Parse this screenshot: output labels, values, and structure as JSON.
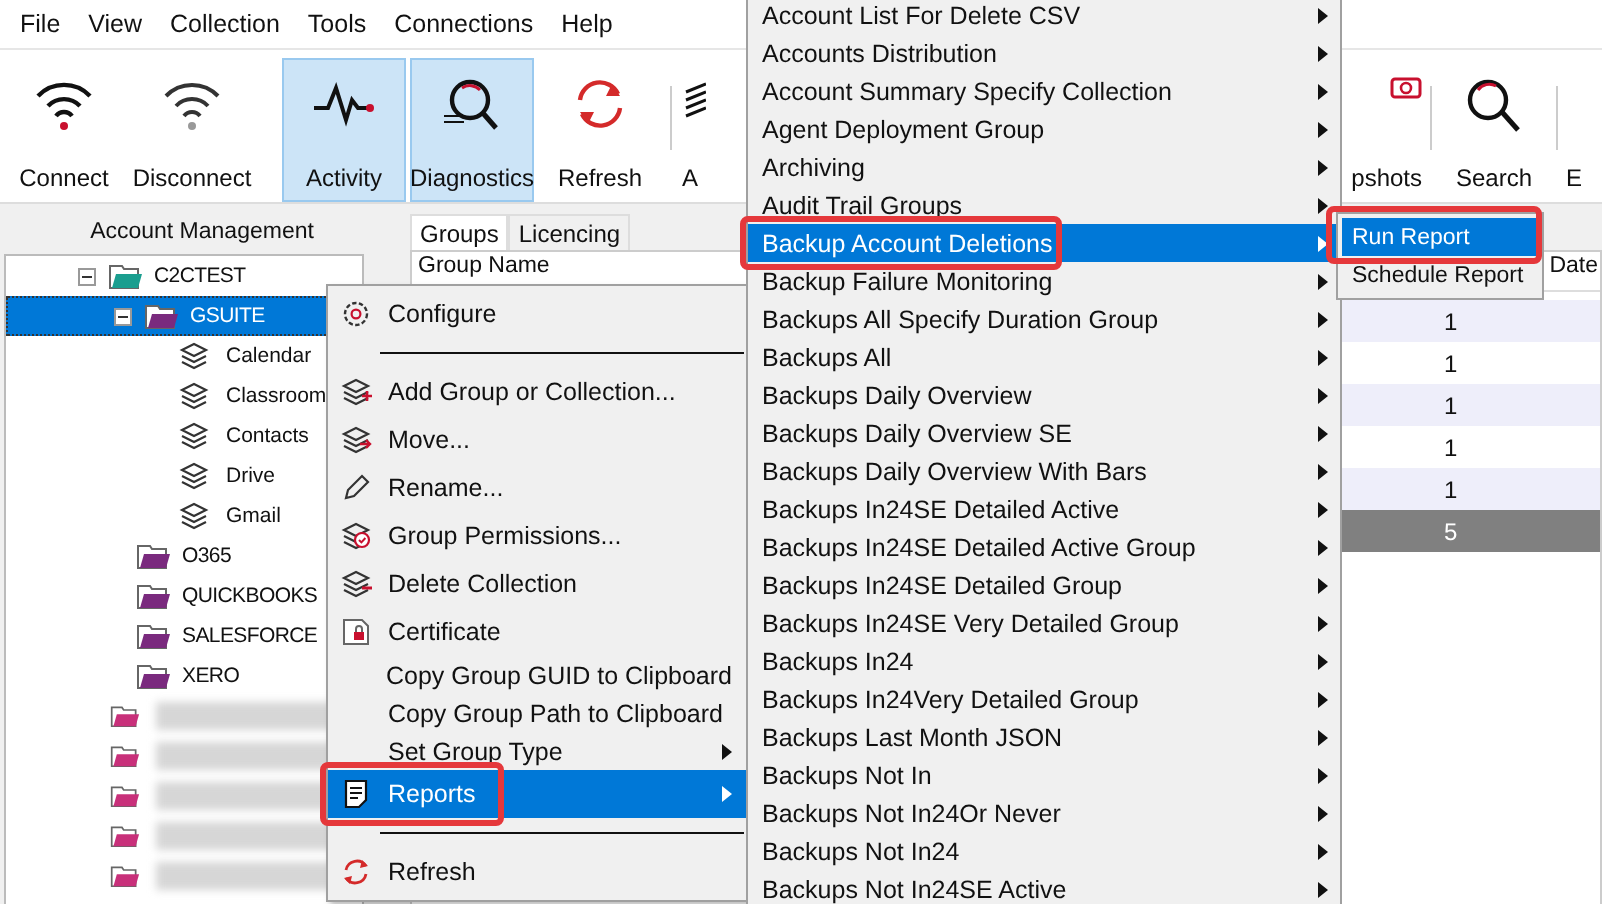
{
  "menu_bar": [
    "File",
    "View",
    "Collection",
    "Tools",
    "Connections",
    "Help"
  ],
  "toolbar": [
    {
      "label": "Connect",
      "selected": false
    },
    {
      "label": "Disconnect",
      "selected": false
    },
    {
      "label": "Activity",
      "selected": true
    },
    {
      "label": "Diagnostics",
      "selected": true
    },
    {
      "label": "Refresh",
      "selected": false
    },
    {
      "label": "A",
      "selected": false
    },
    {
      "label": "pshots",
      "selected": false
    },
    {
      "label": "Search",
      "selected": false
    },
    {
      "label": "E",
      "selected": false
    }
  ],
  "left_panel": {
    "title": "Account Management",
    "tree": [
      {
        "kind": "folder",
        "label": "C2CTEST",
        "color": "#1a9e8f",
        "expanded": true,
        "selected": false,
        "children": [
          {
            "kind": "folder",
            "label": "GSUITE",
            "color": "#7a2a7e",
            "expanded": true,
            "selected": true,
            "children": [
              {
                "kind": "collection",
                "label": "Calendar",
                "selected": false
              },
              {
                "kind": "collection",
                "label": "Classroom",
                "selected": false
              },
              {
                "kind": "collection",
                "label": "Contacts",
                "selected": false
              },
              {
                "kind": "collection",
                "label": "Drive",
                "selected": false
              },
              {
                "kind": "collection",
                "label": "Gmail",
                "selected": false
              }
            ]
          },
          {
            "kind": "folder",
            "label": "O365",
            "color": "#7a2a7e",
            "selected": false
          },
          {
            "kind": "folder",
            "label": "QUICKBOOKS",
            "color": "#7a2a7e",
            "selected": false
          },
          {
            "kind": "folder",
            "label": "SALESFORCE",
            "color": "#7a2a7e",
            "selected": false
          },
          {
            "kind": "folder",
            "label": "XERO",
            "color": "#7a2a7e",
            "selected": false
          }
        ]
      },
      {
        "kind": "blurred",
        "color": "#c8307a",
        "selected": false
      },
      {
        "kind": "blurred",
        "color": "#c8307a",
        "selected": false
      },
      {
        "kind": "blurred",
        "color": "#c8307a",
        "selected": false
      },
      {
        "kind": "blurred",
        "color": "#c8307a",
        "selected": false
      },
      {
        "kind": "blurred",
        "color": "#c8307a",
        "selected": false
      }
    ]
  },
  "tabs": [
    {
      "label": "Groups",
      "selected": true
    },
    {
      "label": "Licencing",
      "selected": false
    }
  ],
  "table": {
    "columns": [
      "Group Name",
      "Date"
    ],
    "rows": [
      {
        "value": "1",
        "selected": false
      },
      {
        "value": "1",
        "selected": false
      },
      {
        "value": "1",
        "selected": false
      },
      {
        "value": "1",
        "selected": false
      },
      {
        "value": "1",
        "selected": false
      },
      {
        "value": "5",
        "selected": true
      }
    ]
  },
  "context_menu": [
    {
      "kind": "item",
      "label": "Configure",
      "selected": false
    },
    {
      "kind": "separator"
    },
    {
      "kind": "item",
      "label": "Add Group or Collection...",
      "selected": false
    },
    {
      "kind": "item",
      "label": "Move...",
      "selected": false
    },
    {
      "kind": "item",
      "label": "Rename...",
      "selected": false
    },
    {
      "kind": "item",
      "label": "Group Permissions...",
      "selected": false
    },
    {
      "kind": "item",
      "label": "Delete Collection",
      "selected": false
    },
    {
      "kind": "item",
      "label": "Certificate",
      "selected": false
    },
    {
      "kind": "plain",
      "label": "Copy Group GUID to Clipboard",
      "selected": false
    },
    {
      "kind": "plain",
      "label": "Copy Group Path to Clipboard",
      "selected": false
    },
    {
      "kind": "submenu",
      "label": "Set Group Type",
      "selected": false
    },
    {
      "kind": "submenu",
      "label": "Reports",
      "selected": true
    },
    {
      "kind": "separator"
    },
    {
      "kind": "item",
      "label": "Refresh",
      "selected": false
    }
  ],
  "reports_menu": [
    {
      "label": "Account List For Delete CSV",
      "selected": false
    },
    {
      "label": "Accounts Distribution",
      "selected": false
    },
    {
      "label": "Account Summary Specify Collection",
      "selected": false
    },
    {
      "label": "Agent Deployment Group",
      "selected": false
    },
    {
      "label": "Archiving",
      "selected": false
    },
    {
      "label": "Audit Trail Groups",
      "selected": false
    },
    {
      "label": "Backup Account Deletions",
      "selected": true
    },
    {
      "label": "Backup Failure Monitoring",
      "selected": false
    },
    {
      "label": "Backups All Specify Duration Group",
      "selected": false
    },
    {
      "label": "Backups All",
      "selected": false
    },
    {
      "label": "Backups Daily Overview",
      "selected": false
    },
    {
      "label": "Backups Daily Overview SE",
      "selected": false
    },
    {
      "label": "Backups Daily Overview With Bars",
      "selected": false
    },
    {
      "label": "Backups In24SE Detailed Active",
      "selected": false
    },
    {
      "label": "Backups In24SE Detailed Active Group",
      "selected": false
    },
    {
      "label": "Backups In24SE Detailed Group",
      "selected": false
    },
    {
      "label": "Backups In24SE Very Detailed Group",
      "selected": false
    },
    {
      "label": "Backups In24",
      "selected": false
    },
    {
      "label": "Backups In24Very Detailed Group",
      "selected": false
    },
    {
      "label": "Backups Last Month JSON",
      "selected": false
    },
    {
      "label": "Backups Not In",
      "selected": false
    },
    {
      "label": "Backups Not In24Or Never",
      "selected": false
    },
    {
      "label": "Backups Not In24",
      "selected": false
    },
    {
      "label": "Backups Not In24SE Active",
      "selected": false
    }
  ],
  "report_actions": [
    {
      "label": "Run Report",
      "selected": true
    },
    {
      "label": "Schedule Report",
      "selected": false
    }
  ]
}
